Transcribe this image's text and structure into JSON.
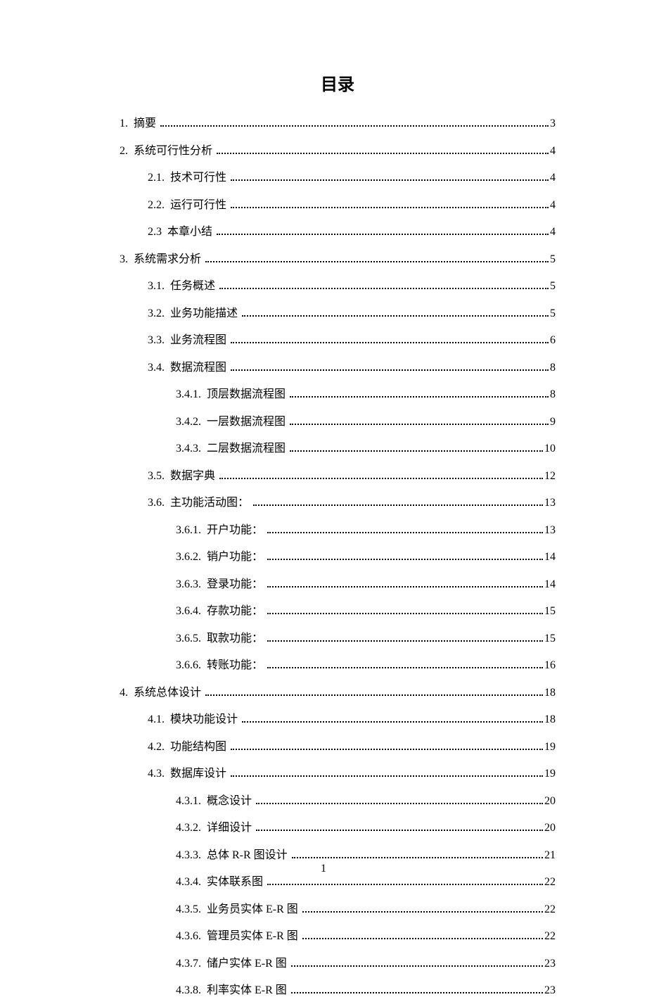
{
  "title": "目录",
  "page_number": "1",
  "toc": [
    {
      "level": 0,
      "label": "1.  摘要 ",
      "page": "3"
    },
    {
      "level": 0,
      "label": "2.  系统可行性分析 ",
      "page": "4"
    },
    {
      "level": 1,
      "label": "2.1.  技术可行性 ",
      "page": "4"
    },
    {
      "level": 1,
      "label": "2.2.  运行可行性 ",
      "page": "4"
    },
    {
      "level": 1,
      "label": "2.3  本章小结 ",
      "page": "4"
    },
    {
      "level": 0,
      "label": "3.  系统需求分析 ",
      "page": "5"
    },
    {
      "level": 1,
      "label": "3.1.  任务概述 ",
      "page": "5"
    },
    {
      "level": 1,
      "label": "3.2.  业务功能描述 ",
      "page": "5"
    },
    {
      "level": 1,
      "label": "3.3.  业务流程图 ",
      "page": "6"
    },
    {
      "level": 1,
      "label": "3.4.  数据流程图 ",
      "page": "8"
    },
    {
      "level": 2,
      "label": "3.4.1.  顶层数据流程图 ",
      "page": "8"
    },
    {
      "level": 2,
      "label": "3.4.2.  一层数据流程图 ",
      "page": "9"
    },
    {
      "level": 2,
      "label": "3.4.3.  二层数据流程图 ",
      "page": "10"
    },
    {
      "level": 1,
      "label": "3.5.  数据字典 ",
      "page": "12"
    },
    {
      "level": 1,
      "label": "3.6.  主功能活动图： ",
      "page": "13"
    },
    {
      "level": 2,
      "label": "3.6.1.  开户功能： ",
      "page": "13"
    },
    {
      "level": 2,
      "label": "3.6.2.  销户功能： ",
      "page": "14"
    },
    {
      "level": 2,
      "label": "3.6.3.  登录功能： ",
      "page": "14"
    },
    {
      "level": 2,
      "label": "3.6.4.  存款功能： ",
      "page": "15"
    },
    {
      "level": 2,
      "label": "3.6.5.  取款功能： ",
      "page": "15"
    },
    {
      "level": 2,
      "label": "3.6.6.  转账功能： ",
      "page": "16"
    },
    {
      "level": 0,
      "label": "4.  系统总体设计 ",
      "page": "18"
    },
    {
      "level": 1,
      "label": "4.1.  模块功能设计 ",
      "page": "18"
    },
    {
      "level": 1,
      "label": "4.2.  功能结构图 ",
      "page": "19"
    },
    {
      "level": 1,
      "label": "4.3.  数据库设计 ",
      "page": "19"
    },
    {
      "level": 2,
      "label": "4.3.1.  概念设计 ",
      "page": "20"
    },
    {
      "level": 2,
      "label": "4.3.2.  详细设计 ",
      "page": "20"
    },
    {
      "level": 2,
      "label": "4.3.3.  总体 R-R 图设计 ",
      "page": "21"
    },
    {
      "level": 2,
      "label": "4.3.4.  实体联系图 ",
      "page": "22"
    },
    {
      "level": 2,
      "label": "4.3.5.  业务员实体 E-R 图 ",
      "page": "22"
    },
    {
      "level": 2,
      "label": "4.3.6.  管理员实体 E-R 图 ",
      "page": "22"
    },
    {
      "level": 2,
      "label": "4.3.7.  储户实体 E-R 图 ",
      "page": "23"
    },
    {
      "level": 2,
      "label": "4.3.8.  利率实体 E-R 图 ",
      "page": "23"
    }
  ]
}
